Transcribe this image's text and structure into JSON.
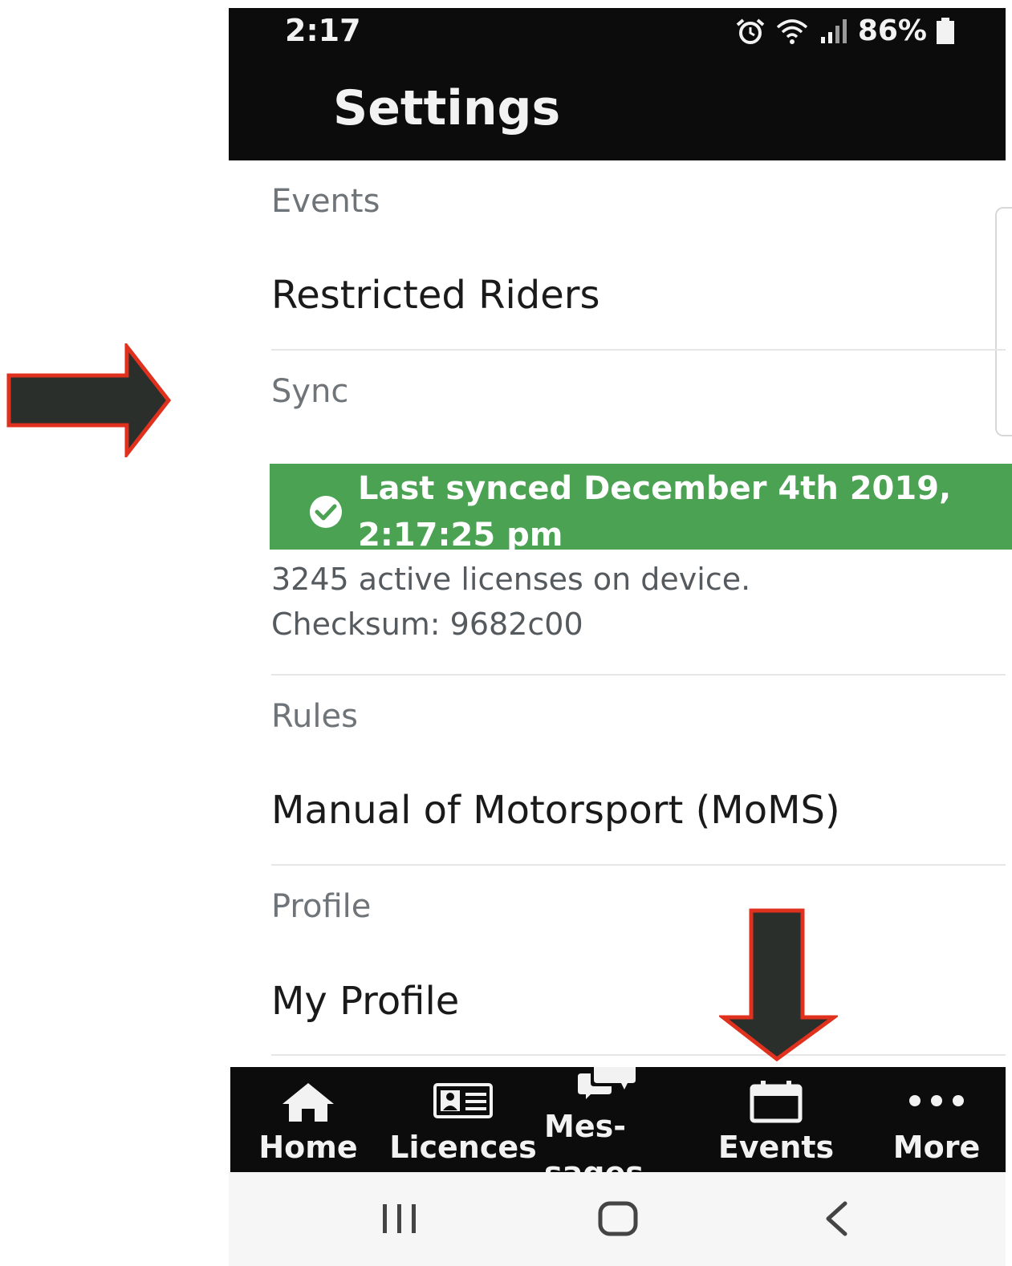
{
  "status_bar": {
    "time": "2:17",
    "battery_percent": "86%"
  },
  "header": {
    "title": "Settings"
  },
  "sections": {
    "events": {
      "label": "Events",
      "item": "Restricted Riders"
    },
    "sync": {
      "label": "Sync",
      "banner_line1": "Last synced December 4th 2019,",
      "banner_line2": "2:17:25 pm",
      "detail_line1": "3245 active licenses on device.",
      "detail_line2": "Checksum: 9682c00"
    },
    "rules": {
      "label": "Rules",
      "item": "Manual of Motorsport (MoMS)"
    },
    "profile": {
      "label": "Profile",
      "item": "My Profile"
    }
  },
  "tabs": [
    {
      "label": "Home",
      "icon": "home-icon"
    },
    {
      "label": "Licences",
      "icon": "id-card-icon"
    },
    {
      "label": "Mes-",
      "label_cont": "sages",
      "icon": "chat-icon"
    },
    {
      "label": "Events",
      "icon": "calendar-icon"
    },
    {
      "label": "More",
      "icon": "more-dots-icon"
    }
  ],
  "colors": {
    "header_bg": "#0c0c0c",
    "sync_banner": "#4aa252",
    "annotation_arrow_fill": "#2b2f2c",
    "annotation_arrow_stroke": "#e0301e"
  }
}
